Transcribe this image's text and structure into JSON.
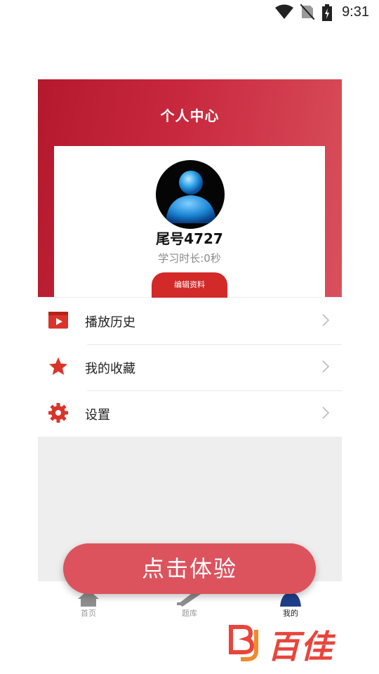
{
  "status_bar": {
    "time": "9:31"
  },
  "header": {
    "title": "个人中心"
  },
  "profile": {
    "username": "尾号4727",
    "study_time": "学习时长:0秒",
    "edit_label": "编辑资料"
  },
  "menu": {
    "items": [
      {
        "label": "播放历史",
        "icon": "play-history-icon"
      },
      {
        "label": "我的收藏",
        "icon": "star-icon"
      },
      {
        "label": "设置",
        "icon": "gear-icon"
      }
    ]
  },
  "tabbar": {
    "tabs": [
      {
        "label": "首页",
        "icon": "home-icon"
      },
      {
        "label": "题库",
        "icon": "pen-icon"
      },
      {
        "label": "我的",
        "icon": "person-icon"
      }
    ],
    "active_index": 2
  },
  "cta": {
    "label": "点击体验"
  },
  "watermark": {
    "text": "百佳",
    "logo": "BJ"
  },
  "colors": {
    "brand_red": "#c9293e",
    "cta": "#dc535e",
    "icon_red": "#d9342b",
    "tab_active": "#1f3f8a"
  }
}
